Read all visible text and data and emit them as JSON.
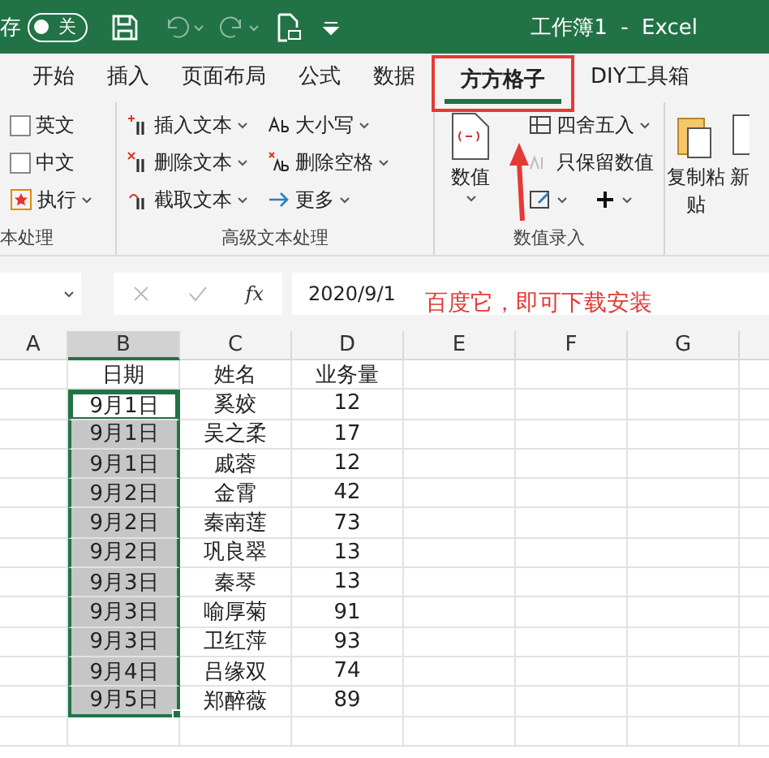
{
  "title_bar": {
    "autosave_label": "存",
    "autosave_toggle": {
      "label": "关",
      "on": false
    },
    "title": "工作簿1  -  Excel"
  },
  "tabs": [
    {
      "label": "开始",
      "selected": false
    },
    {
      "label": "插入",
      "selected": false
    },
    {
      "label": "页面布局",
      "selected": false
    },
    {
      "label": "公式",
      "selected": false
    },
    {
      "label": "数据",
      "selected": false
    },
    {
      "label": "方方格子",
      "selected": true
    },
    {
      "label": "DIY工具箱",
      "selected": false
    }
  ],
  "ribbon": {
    "text_group": {
      "label": "本处理",
      "checkboxes": [
        {
          "label": "英文",
          "checked": false
        },
        {
          "label": "中文",
          "checked": false
        }
      ],
      "run_button": "执行"
    },
    "advanced_text": {
      "label": "高级文本处理",
      "buttons": [
        "插入文本",
        "删除文本",
        "截取文本",
        "大小写",
        "删除空格",
        "更多"
      ]
    },
    "number_entry": {
      "label": "数值录入",
      "big_button": "数值",
      "buttons": [
        "四舍五入",
        "只保留数值"
      ]
    },
    "clipboard": {
      "copy_paste": "复制粘贴",
      "next": "新"
    }
  },
  "formula_bar": {
    "fx": "fx",
    "value": "2020/9/1"
  },
  "annotation": {
    "text": "百度它，即可下载安装"
  },
  "sheet": {
    "columns": [
      {
        "label": "A",
        "selected": false
      },
      {
        "label": "B",
        "selected": true
      },
      {
        "label": "C",
        "selected": false
      },
      {
        "label": "D",
        "selected": false
      },
      {
        "label": "E",
        "selected": false
      },
      {
        "label": "F",
        "selected": false
      },
      {
        "label": "G",
        "selected": false
      }
    ],
    "rows": [
      {
        "date": "日期",
        "name": "姓名",
        "amount": "业务量",
        "selected": false,
        "active": false
      },
      {
        "date": "9月1日",
        "name": "奚姣",
        "amount": "12",
        "selected": true,
        "active": true
      },
      {
        "date": "9月1日",
        "name": "吴之柔",
        "amount": "17",
        "selected": true,
        "active": false
      },
      {
        "date": "9月1日",
        "name": "戚蓉",
        "amount": "12",
        "selected": true,
        "active": false
      },
      {
        "date": "9月2日",
        "name": "金霄",
        "amount": "42",
        "selected": true,
        "active": false
      },
      {
        "date": "9月2日",
        "name": "秦南莲",
        "amount": "73",
        "selected": true,
        "active": false
      },
      {
        "date": "9月2日",
        "name": "巩良翠",
        "amount": "13",
        "selected": true,
        "active": false
      },
      {
        "date": "9月3日",
        "name": "秦琴",
        "amount": "13",
        "selected": true,
        "active": false
      },
      {
        "date": "9月3日",
        "name": "喻厚菊",
        "amount": "91",
        "selected": true,
        "active": false
      },
      {
        "date": "9月3日",
        "name": "卫红萍",
        "amount": "93",
        "selected": true,
        "active": false
      },
      {
        "date": "9月4日",
        "name": "吕缘双",
        "amount": "74",
        "selected": true,
        "active": false
      },
      {
        "date": "9月5日",
        "name": "郑醉薇",
        "amount": "89",
        "selected": true,
        "active": false
      }
    ]
  }
}
